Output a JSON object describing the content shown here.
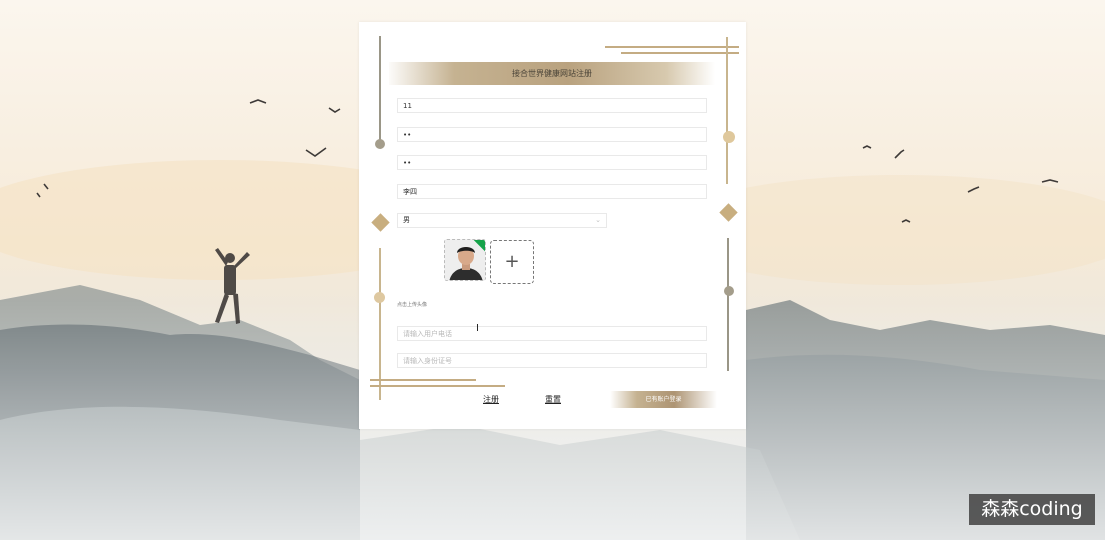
{
  "form": {
    "title": "接合世界健康网站注册",
    "fields": {
      "username": "11",
      "password": "••",
      "confirm_password": "••",
      "name": "李四",
      "gender": "男",
      "phone_placeholder": "请输入用户电话",
      "idcard_placeholder": "请输入身份证号"
    },
    "upload_hint": "点击上传头像",
    "add_symbol": "+",
    "register_label": "注册",
    "reset_label": "重置",
    "login_link_label": "已有账户登录"
  },
  "watermark": "森森coding",
  "colors": {
    "accent_gold": "#c8ae7f",
    "line_gray": "#9a9687",
    "success_badge": "#16a34a"
  }
}
